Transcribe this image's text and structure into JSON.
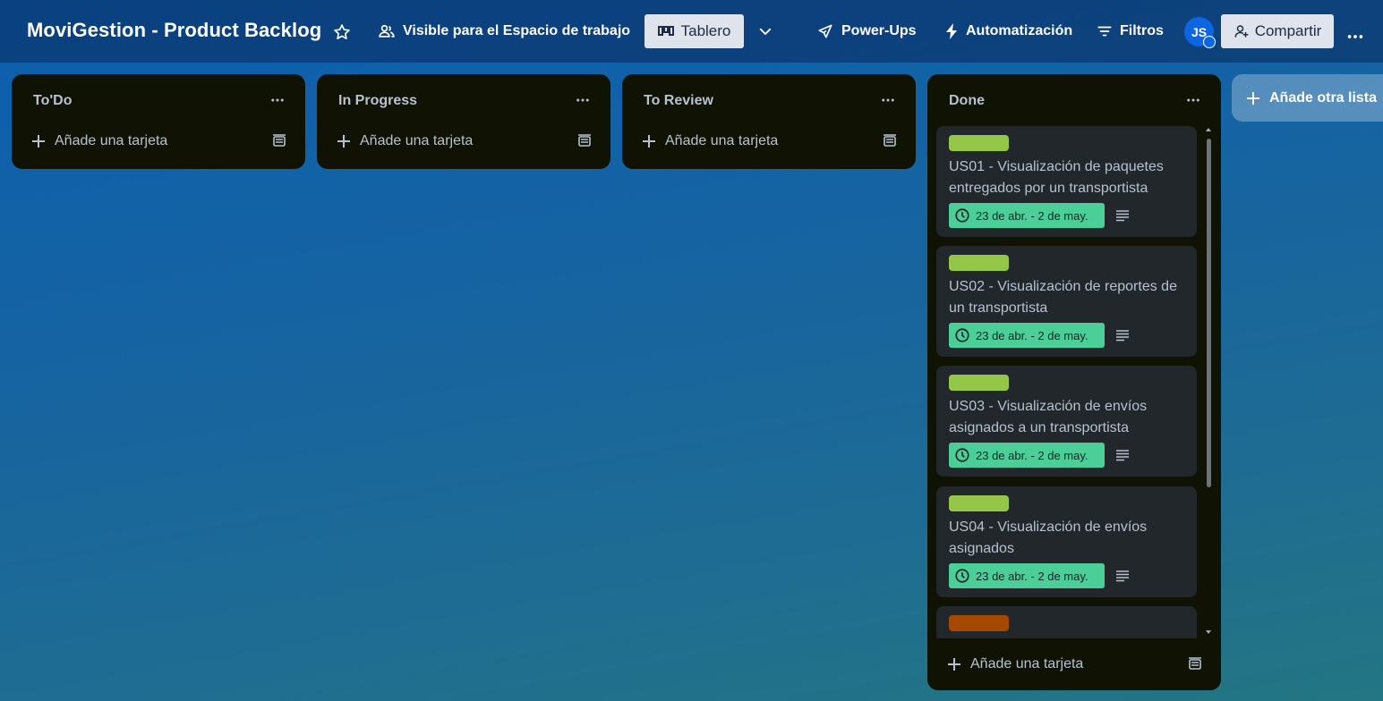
{
  "header": {
    "board_title": "MoviGestion - Product Backlog",
    "visibility_label": "Visible para el Espacio de trabajo",
    "view_label": "Tablero",
    "powerups_label": "Power-Ups",
    "automation_label": "Automatización",
    "filters_label": "Filtros",
    "avatar_initials": "JS",
    "share_label": "Compartir"
  },
  "lists": [
    {
      "title": "To'Do",
      "add_card_label": "Añade una tarjeta"
    },
    {
      "title": "In Progress",
      "add_card_label": "Añade una tarjeta"
    },
    {
      "title": "To Review",
      "add_card_label": "Añade una tarjeta"
    },
    {
      "title": "Done",
      "add_card_label": "Añade una tarjeta",
      "cards": [
        {
          "title": "US01 - Visualización de paquetes entregados por un transportista",
          "dates": "23 de abr. - 2 de may.",
          "label_color": "#94c748"
        },
        {
          "title": "US02 - Visualización de reportes de un transportista",
          "dates": "23 de abr. - 2 de may.",
          "label_color": "#94c748"
        },
        {
          "title": "US03 - Visualización de envíos asignados a un transportista",
          "dates": "23 de abr. - 2 de may.",
          "label_color": "#94c748"
        },
        {
          "title": "US04 - Visualización de envíos asignados",
          "dates": "23 de abr. - 2 de may.",
          "label_color": "#94c748"
        },
        {
          "title": "",
          "label_color": "#a54800"
        }
      ]
    }
  ],
  "add_list_label": "Añade otra lista",
  "colors": {
    "list_bg": "#101204",
    "card_bg": "#22272b",
    "date_badge": "#4bce97",
    "label_green": "#94c748",
    "label_orange": "#a54800"
  }
}
